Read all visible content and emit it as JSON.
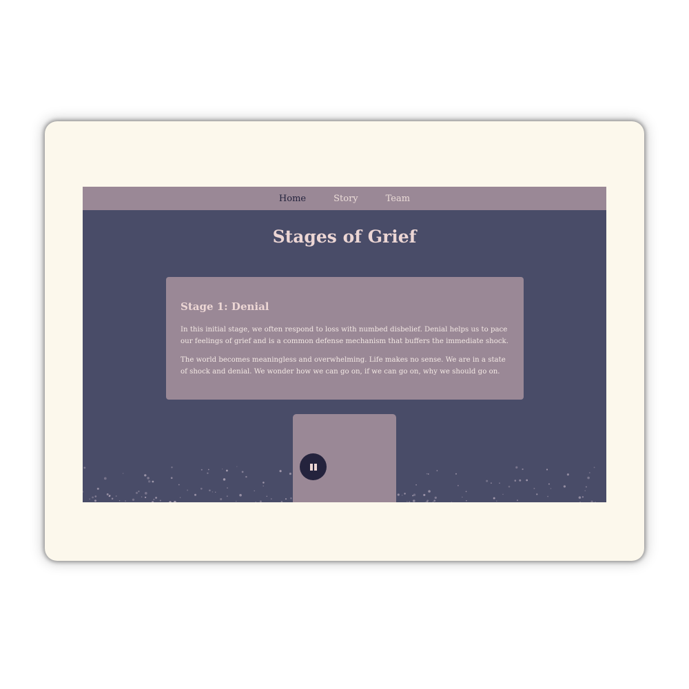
{
  "nav": {
    "items": [
      {
        "label": "Home",
        "active": true
      },
      {
        "label": "Story",
        "active": false
      },
      {
        "label": "Team",
        "active": false
      }
    ]
  },
  "page": {
    "title": "Stages of Grief"
  },
  "stage_card": {
    "title": "Stage 1: Denial",
    "paragraphs": [
      "In this initial stage, we often respond to loss with numbed disbelief. Denial helps us to pace our feelings of grief and is a common defense mechanism that buffers the immediate shock.",
      "The world becomes meaningless and overwhelming. Life makes no sense. We are in a state of shock and denial. We wonder how we can go on, if we can go on, why we should go on."
    ]
  },
  "media": {
    "playback_state": "playing",
    "control_icon": "pause-icon"
  },
  "colors": {
    "device_frame": "#fcf8ec",
    "background": "#494c68",
    "panel": "#9a8896",
    "accent_dark": "#24233d",
    "text_light": "#ecd6d4"
  }
}
